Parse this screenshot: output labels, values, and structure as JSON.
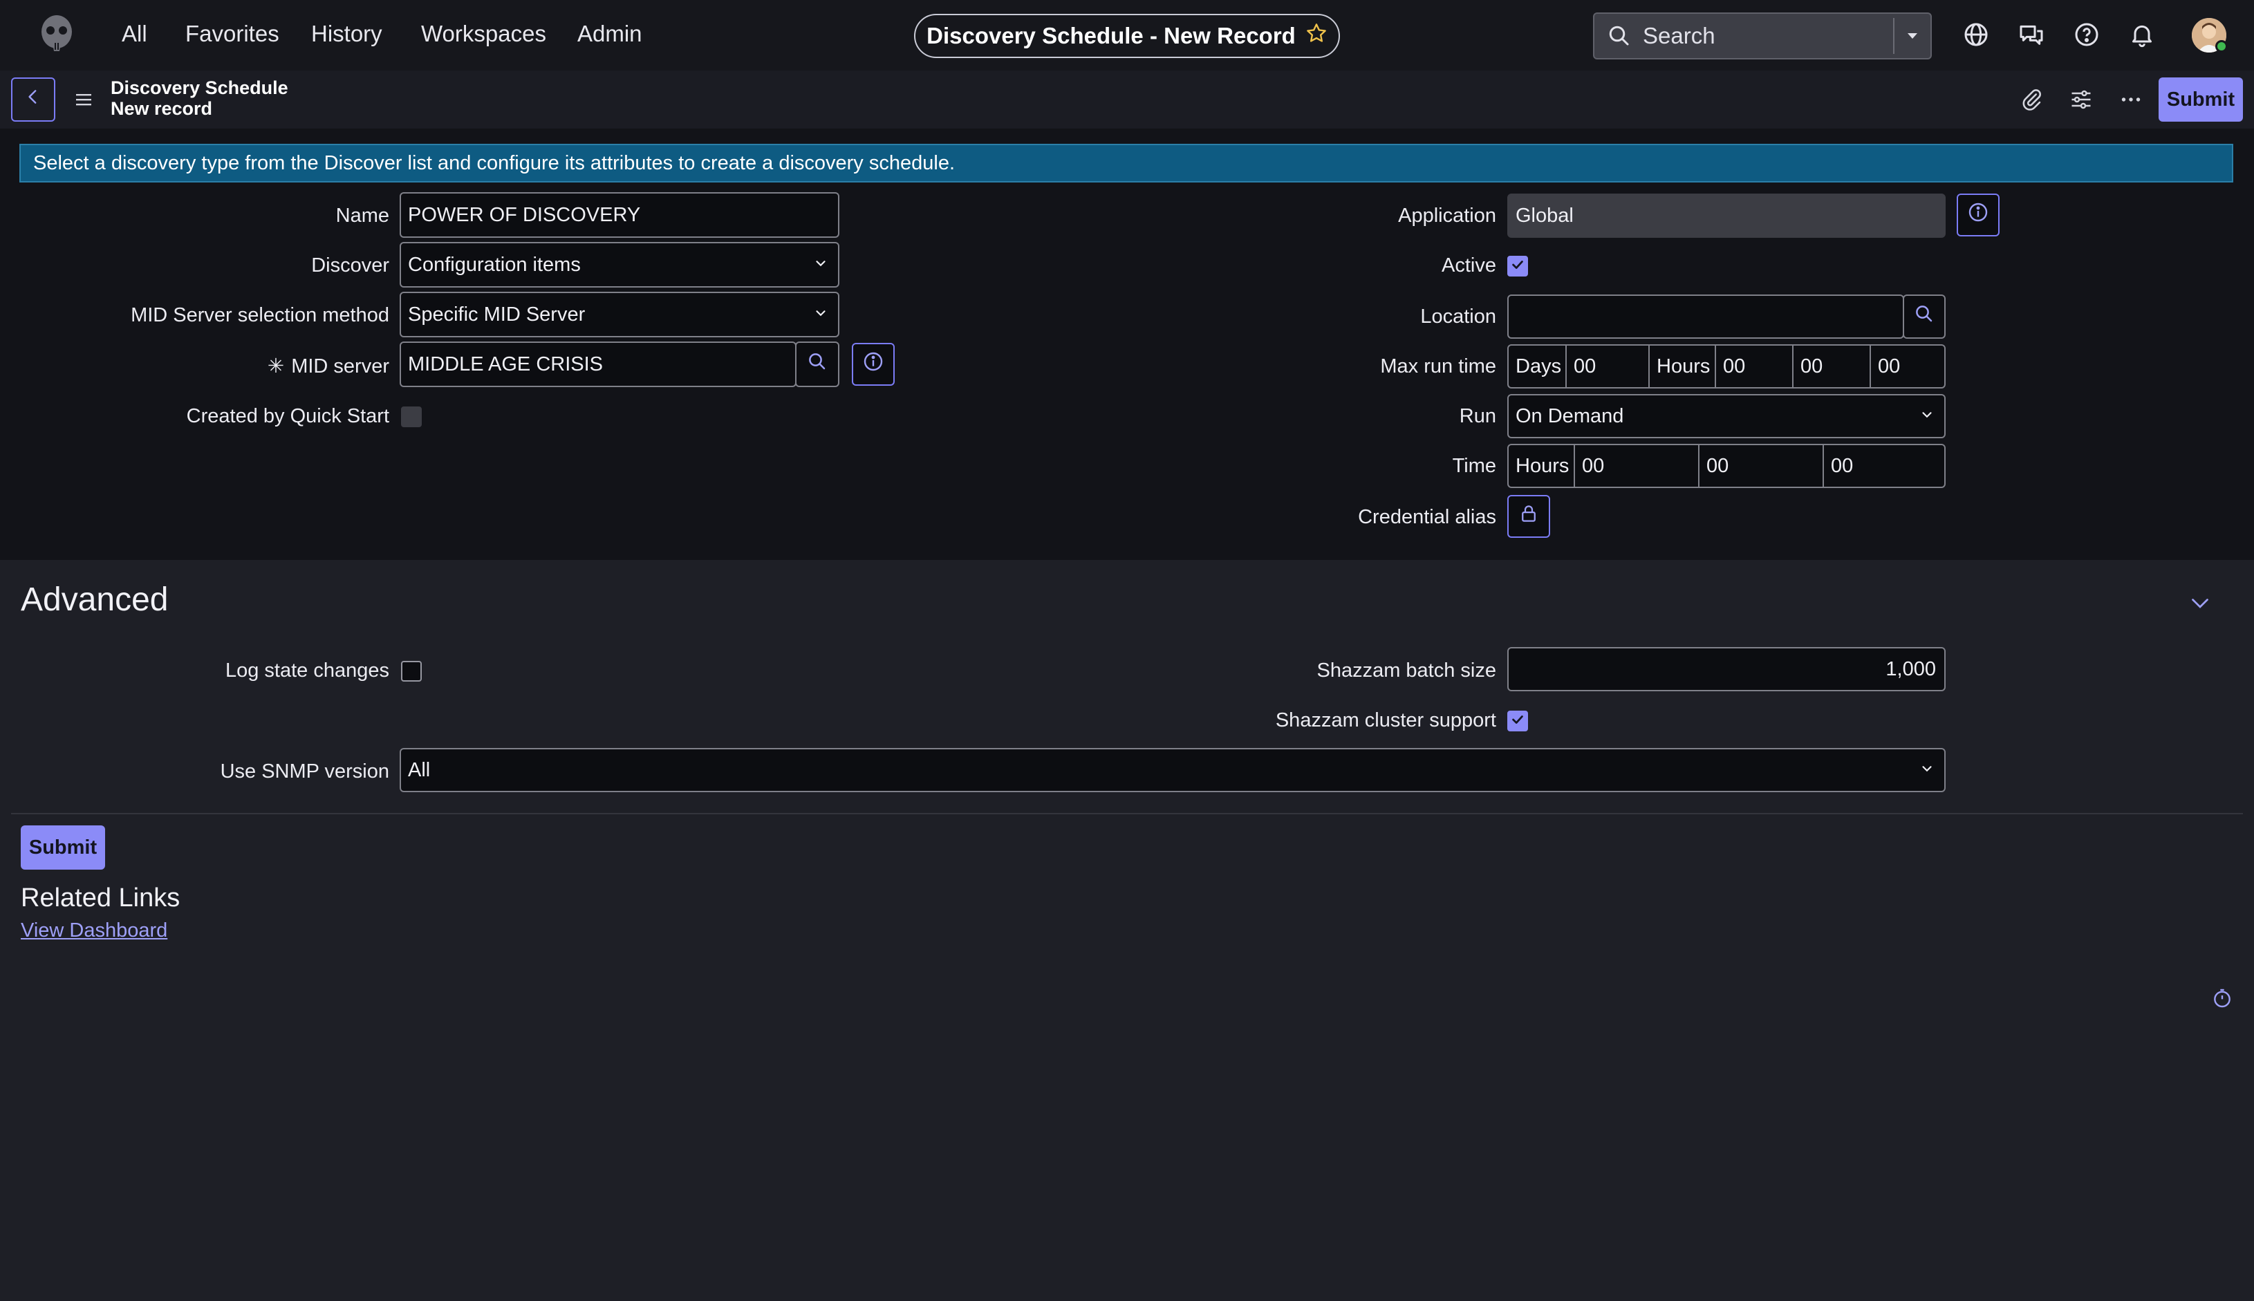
{
  "topnav": {
    "links": [
      "All",
      "Favorites",
      "History",
      "Workspaces",
      "Admin"
    ],
    "record_title": "Discovery Schedule - New Record",
    "search_placeholder": "Search"
  },
  "form_header": {
    "table_name": "Discovery Schedule",
    "record_state": "New record",
    "submit_label": "Submit"
  },
  "banner": {
    "text": "Select a discovery type from the Discover list and configure its attributes to create a discovery schedule."
  },
  "fields": {
    "name": {
      "label": "Name",
      "value": "POWER OF DISCOVERY"
    },
    "discover": {
      "label": "Discover",
      "value": "Configuration items"
    },
    "mid_selection": {
      "label": "MID Server selection method",
      "value": "Specific MID Server"
    },
    "mid_server": {
      "label": "MID server",
      "required_mark": "✳",
      "value": "MIDDLE AGE CRISIS"
    },
    "quick_start": {
      "label": "Created by Quick Start",
      "checked": false
    },
    "application": {
      "label": "Application",
      "value": "Global"
    },
    "active": {
      "label": "Active",
      "checked": true
    },
    "location": {
      "label": "Location",
      "value": ""
    },
    "max_run_time": {
      "label": "Max run time",
      "days_label": "Days",
      "days": "00",
      "hours_label": "Hours",
      "hours": "00",
      "minutes": "00",
      "seconds": "00"
    },
    "run": {
      "label": "Run",
      "value": "On Demand"
    },
    "time": {
      "label": "Time",
      "hours_label": "Hours",
      "hours": "00",
      "minutes": "00",
      "seconds": "00"
    },
    "credential_alias": {
      "label": "Credential alias"
    }
  },
  "advanced": {
    "title": "Advanced",
    "log_state_changes": {
      "label": "Log state changes",
      "checked": false
    },
    "shazzam_batch_size": {
      "label": "Shazzam batch size",
      "value": "1,000"
    },
    "shazzam_cluster_support": {
      "label": "Shazzam cluster support",
      "checked": true
    },
    "snmp_version": {
      "label": "Use SNMP version",
      "value": "All"
    }
  },
  "footer": {
    "submit_label": "Submit",
    "related_links_title": "Related Links",
    "view_dashboard": "View Dashboard"
  },
  "colors": {
    "accent": "#8b8bf7",
    "banner": "#0e5b82",
    "background": "#121318"
  }
}
